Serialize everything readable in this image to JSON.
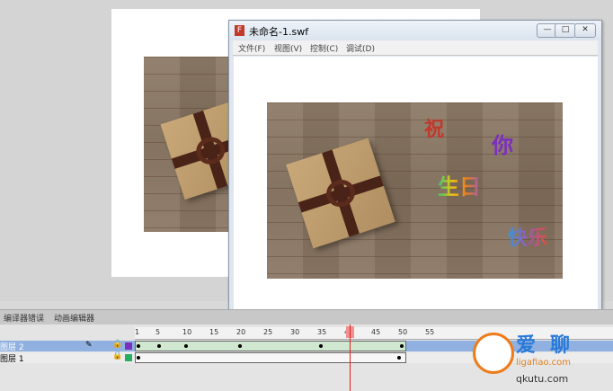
{
  "player": {
    "title": "未命名-1.swf",
    "app_icon": "F",
    "menu": [
      {
        "label": "文件(F)"
      },
      {
        "label": "视图(V)"
      },
      {
        "label": "控制(C)"
      },
      {
        "label": "调试(D)"
      }
    ],
    "controls": {
      "minimize": "—",
      "maximize": "□",
      "close": "✕"
    },
    "greeting": {
      "c1": "祝",
      "c2": "你",
      "c3": "生日",
      "c4": "快乐"
    }
  },
  "panels": {
    "tabs": [
      {
        "label": "编译器错误"
      },
      {
        "label": "动画编辑器"
      }
    ]
  },
  "timeline": {
    "ruler": [
      "1",
      "5",
      "10",
      "15",
      "20",
      "25",
      "30",
      "35",
      "40",
      "45",
      "50",
      "55"
    ],
    "layers": [
      {
        "name": "图层 2",
        "selected": true
      },
      {
        "name": "图层 1",
        "selected": false
      }
    ],
    "current_frame": 40,
    "last_keyframe": 50
  },
  "watermark": {
    "text1": "爱",
    "text2": "聊",
    "url": "ligafiao.com",
    "site": "qkutu.com"
  },
  "colors": {
    "accent": "#8fb0e0",
    "playhead": "#e02020",
    "greet1": "#c0392b",
    "greet2": "#7b2fbe"
  }
}
